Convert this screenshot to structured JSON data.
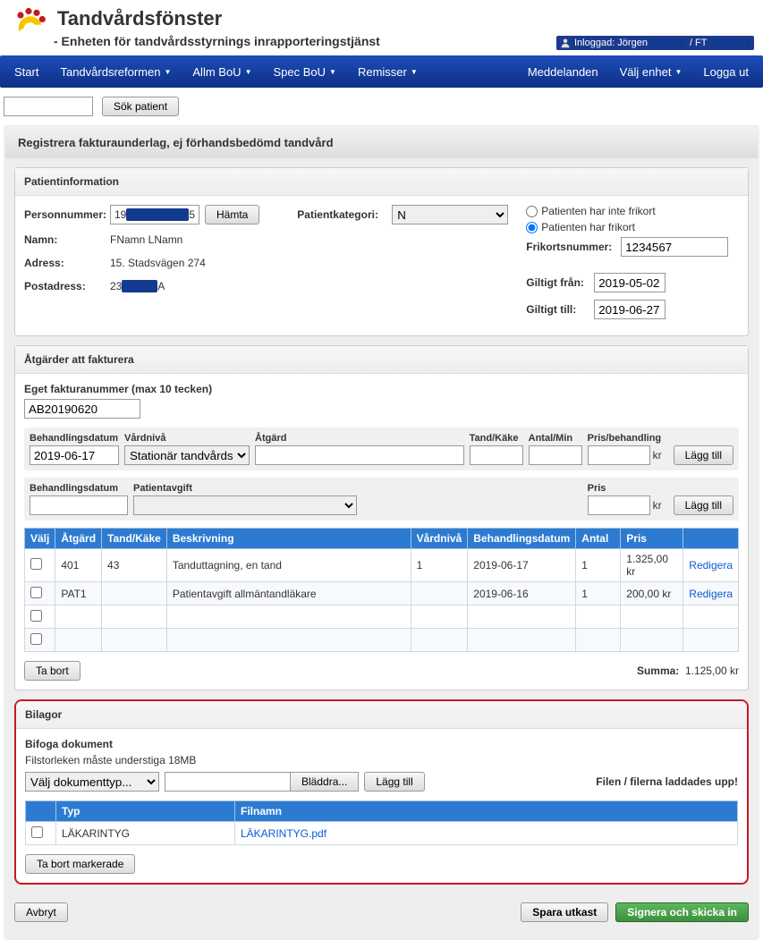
{
  "header": {
    "title": "Tandvårdsfönster",
    "subtitle": "- Enheten för tandvårdsstyrnings inrapporteringstjänst",
    "login_prefix": "Inloggad: Jörgen",
    "login_sep": " / FT"
  },
  "nav": {
    "left": [
      "Start",
      "Tandvårdsreformen",
      "Allm BoU",
      "Spec BoU",
      "Remisser"
    ],
    "right": [
      "Meddelanden",
      "Välj enhet",
      "Logga ut"
    ]
  },
  "search": {
    "btn": "Sök patient"
  },
  "page_title": "Registrera fakturaunderlag, ej förhandsbedömd tandvård",
  "patient": {
    "section": "Patientinformation",
    "labels": {
      "pnr": "Personnummer:",
      "name": "Namn:",
      "addr": "Adress:",
      "post": "Postadress:",
      "cat": "Patientkategori:",
      "frino": "Frikortsnummer:",
      "from": "Giltigt från:",
      "till": "Giltigt till:"
    },
    "pnr_prefix": "19",
    "pnr_suffix": "5",
    "hamta": "Hämta",
    "name": "FNamn LNamn",
    "addr": "15. Stadsvägen 274",
    "post_prefix": "23",
    "post_suffix": "A",
    "cat": "N",
    "radio_no": "Patienten har inte frikort",
    "radio_yes": "Patienten har frikort",
    "frikort": "1234567",
    "from": "2019-05-02",
    "till": "2019-06-27"
  },
  "actions": {
    "section": "Åtgärder att fakturera",
    "eget_label": "Eget fakturanummer (max 10 tecken)",
    "eget_val": "AB20190620",
    "row1": {
      "behdat": "Behandlingsdatum",
      "vardniva": "Vårdnivå",
      "atgard": "Åtgärd",
      "tand": "Tand/Käke",
      "antal": "Antal/Min",
      "pris": "Pris/behandling",
      "kr": "kr",
      "lagg": "Lägg till",
      "behdat_val": "2019-06-17",
      "vardniva_val": "Stationär tandvårdsin"
    },
    "row2": {
      "behdat": "Behandlingsdatum",
      "patavg": "Patientavgift",
      "pris": "Pris",
      "kr": "kr",
      "lagg": "Lägg till"
    },
    "cols": [
      "Välj",
      "Åtgärd",
      "Tand/Käke",
      "Beskrivning",
      "Vårdnivå",
      "Behandlingsdatum",
      "Antal",
      "Pris",
      ""
    ],
    "rows": [
      {
        "atgard": "401",
        "tand": "43",
        "beskr": "Tanduttagning, en tand",
        "niva": "1",
        "dat": "2019-06-17",
        "antal": "1",
        "pris": "1.325,00 kr",
        "edit": "Redigera"
      },
      {
        "atgard": "PAT1",
        "tand": "",
        "beskr": "Patientavgift allmäntandläkare",
        "niva": "",
        "dat": "2019-06-16",
        "antal": "1",
        "pris": "200,00 kr",
        "edit": "Redigera"
      }
    ],
    "tabort": "Ta bort",
    "summa_lbl": "Summa:",
    "summa_val": "1.125,00 kr"
  },
  "bilagor": {
    "section": "Bilagor",
    "bifoga": "Bifoga dokument",
    "hint": "Filstorleken måste understiga 18MB",
    "valj": "Välj dokumenttyp...",
    "bladdra": "Bläddra...",
    "lagg": "Lägg till",
    "msg": "Filen / filerna laddades upp!",
    "cols": [
      "",
      "Typ",
      "Filnamn"
    ],
    "rows": [
      {
        "typ": "LÄKARINTYG",
        "fil": "LÄKARINTYG.pdf"
      }
    ],
    "tabort": "Ta bort markerade"
  },
  "footer": {
    "avbryt": "Avbryt",
    "spara": "Spara utkast",
    "signera": "Signera och skicka in"
  }
}
